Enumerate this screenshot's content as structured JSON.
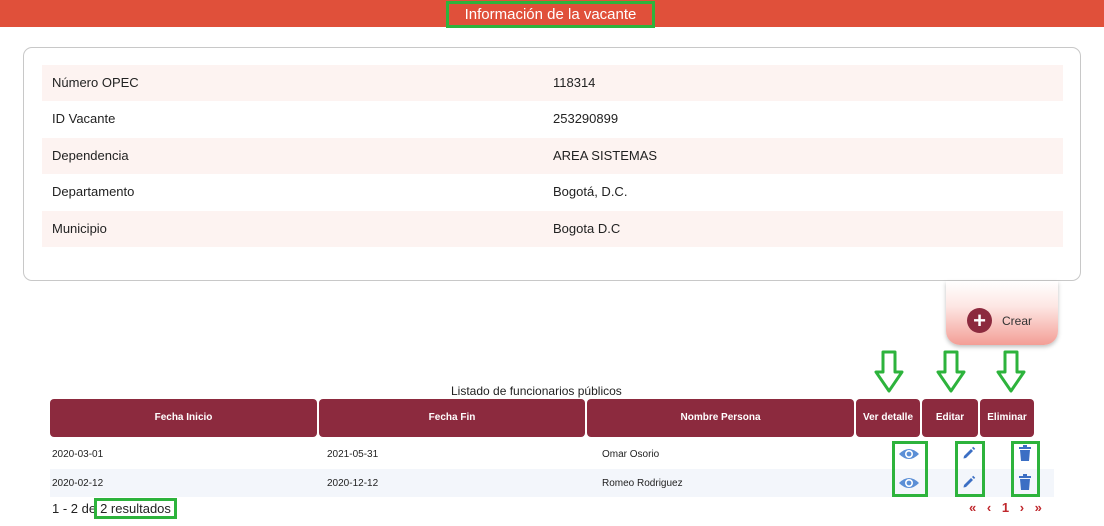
{
  "header": {
    "title": "Información de la vacante"
  },
  "vacancy_info": [
    {
      "label": "Número OPEC",
      "value": "118314"
    },
    {
      "label": "ID Vacante",
      "value": "253290899"
    },
    {
      "label": "Dependencia",
      "value": "AREA SISTEMAS"
    },
    {
      "label": "Departamento",
      "value": "Bogotá, D.C."
    },
    {
      "label": "Municipio",
      "value": "Bogota D.C"
    }
  ],
  "create_button": {
    "label": "Crear",
    "icon": "plus-circle-icon"
  },
  "table": {
    "caption": "Listado de funcionarios públicos",
    "columns": [
      "Fecha Inicio",
      "Fecha Fin",
      "Nombre Persona",
      "Ver detalle",
      "Editar",
      "Eliminar"
    ],
    "rows": [
      [
        "2020-03-01",
        "2021-05-31",
        "Omar Osorio"
      ],
      [
        "2020-02-12",
        "2020-12-12",
        "Romeo Rodriguez"
      ]
    ]
  },
  "pagination": {
    "summary_prefix": "1 - 2 de",
    "summary_highlight": "2 resultados",
    "first": "«",
    "prev": "‹",
    "page": "1",
    "next": "›",
    "last": "»"
  },
  "colors": {
    "header": "#e0503a",
    "table_header": "#8c2a3e",
    "highlight": "#2db33c",
    "icon_blue": "#5b8fd6"
  }
}
